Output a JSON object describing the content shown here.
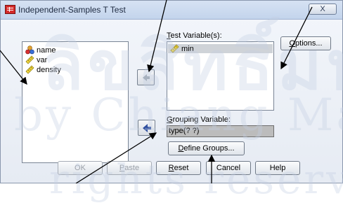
{
  "dialog": {
    "title": "Independent-Samples T Test",
    "close_label": "X"
  },
  "source_variables": [
    {
      "label": "name",
      "icon": "nominal-variable-icon"
    },
    {
      "label": "var",
      "icon": "scale-variable-icon"
    },
    {
      "label": "density",
      "icon": "scale-variable-icon"
    }
  ],
  "test_variables": {
    "label_underline": "T",
    "label_rest": "est Variable(s):",
    "items": [
      {
        "label": "min",
        "icon": "scale-variable-icon",
        "selected": true
      }
    ]
  },
  "grouping_variable": {
    "label_underline": "G",
    "label_rest": "rouping Variable:",
    "value": "type(? ?)"
  },
  "buttons": {
    "options_underline": "O",
    "options_rest": "ptions...",
    "define_groups_underline": "D",
    "define_groups_rest": "efine Groups...",
    "ok": "OK",
    "paste_underline": "P",
    "paste_rest": "aste",
    "reset_underline": "R",
    "reset_rest": "eset",
    "cancel": "Cancel",
    "help": "Help"
  },
  "watermark": {
    "line1": "ลิขสิทธิ์มหาวิทยาลัย",
    "line2": "by Chiang Mai",
    "line3": "rights reserved"
  },
  "colors": {
    "title_bar": "#c3d4ec",
    "dialog_bg": "#e6ebf3",
    "grouping_field_bg": "#bcbcbc",
    "arrow_icon": "#2f4f9f"
  }
}
